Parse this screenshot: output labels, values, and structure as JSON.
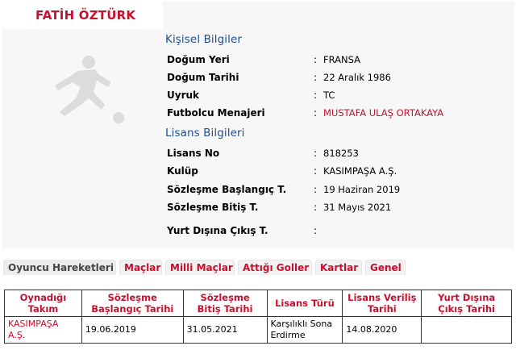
{
  "player": {
    "name": "FATİH ÖZTÜRK",
    "avatar_icon": "football-player-silhouette-icon"
  },
  "personal": {
    "title": "Kişisel Bilgiler",
    "rows": [
      {
        "label": "Doğum Yeri",
        "value": "FRANSA"
      },
      {
        "label": "Doğum Tarihi",
        "value": "22 Aralık 1986"
      },
      {
        "label": "Uyruk",
        "value": "TC"
      },
      {
        "label": "Futbolcu Menajeri",
        "value": "MUSTAFA ULAŞ ORTAKAYA"
      }
    ]
  },
  "license": {
    "title": "Lisans Bilgileri",
    "rows": [
      {
        "label": "Lisans No",
        "value": "818253"
      },
      {
        "label": "Kulüp",
        "value": "KASIMPAŞA A.Ş."
      },
      {
        "label": "Sözleşme Başlangıç T.",
        "value": "19 Haziran 2019"
      },
      {
        "label": "Sözleşme Bitiş T.",
        "value": "31 Mayıs 2021"
      },
      {
        "label": "Yurt Dışına Çıkış T.",
        "value": ""
      }
    ]
  },
  "colon": ":",
  "tabs": [
    "Oyuncu Hareketleri",
    "Maçlar",
    "Milli Maçlar",
    "Attığı Goller",
    "Kartlar",
    "Genel"
  ],
  "table": {
    "headers": [
      [
        "Oynadığı",
        "Takım"
      ],
      [
        "Sözleşme",
        "Başlangıç Tarihi"
      ],
      [
        "Sözleşme",
        "Bitiş Tarihi"
      ],
      [
        "Lisans Türü"
      ],
      [
        "Lisans Veriliş",
        "Tarihi"
      ],
      [
        "Yurt Dışına",
        "Çıkış Tarihi"
      ]
    ],
    "rows": [
      {
        "team": [
          "KASIMPAŞA",
          "A.Ş."
        ],
        "start": "19.06.2019",
        "end": "31.05.2021",
        "license_type": [
          "Karşılıklı Sona",
          "Erdirme"
        ],
        "issued": "14.08.2020",
        "abroad": ""
      }
    ]
  },
  "colors": {
    "accent_red": "#c8102e",
    "section_blue": "#1f4e8c",
    "panel_bg": "#f7f7f7"
  }
}
